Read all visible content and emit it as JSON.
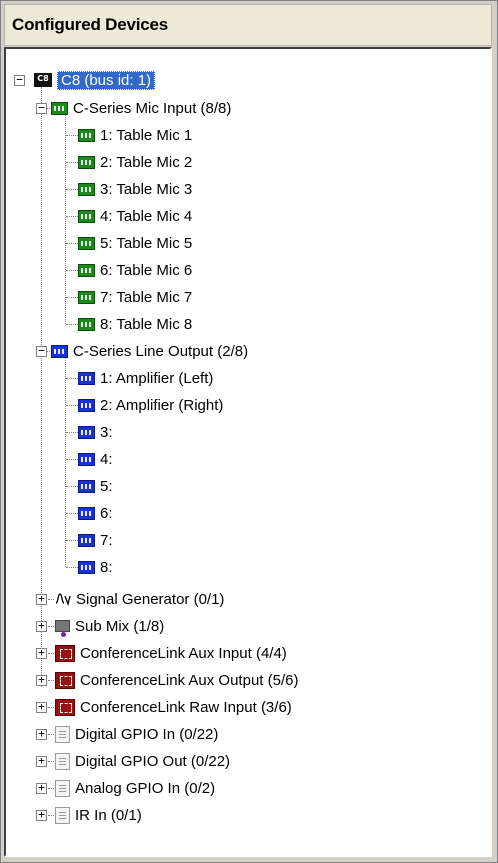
{
  "panel": {
    "title": "Configured Devices"
  },
  "device": {
    "icon_text": "C8",
    "label": "C8 (bus id: 1)"
  },
  "mic_group": {
    "label": "C-Series Mic Input (8/8)",
    "items": [
      "1: Table Mic 1",
      "2: Table Mic 2",
      "3: Table Mic 3",
      "4: Table Mic 4",
      "5: Table Mic 5",
      "6: Table Mic 6",
      "7: Table Mic 7",
      "8: Table Mic 8"
    ]
  },
  "line_group": {
    "label": "C-Series Line Output (2/8)",
    "items": [
      "1: Amplifier (Left)",
      "2: Amplifier (Right)",
      "3:",
      "4:",
      "5:",
      "6:",
      "7:",
      "8:"
    ]
  },
  "other_groups": [
    {
      "label": "Signal Generator (0/1)",
      "icon": "signal-generator-icon"
    },
    {
      "label": "Sub Mix (1/8)",
      "icon": "sub-mix-icon"
    },
    {
      "label": "ConferenceLink Aux Input (4/4)",
      "icon": "conferencelink-icon"
    },
    {
      "label": "ConferenceLink Aux Output (5/6)",
      "icon": "conferencelink-icon"
    },
    {
      "label": "ConferenceLink Raw Input (3/6)",
      "icon": "conferencelink-icon"
    },
    {
      "label": "Digital GPIO In (0/22)",
      "icon": "gpio-icon"
    },
    {
      "label": "Digital GPIO Out (0/22)",
      "icon": "gpio-icon"
    },
    {
      "label": "Analog GPIO In (0/2)",
      "icon": "gpio-icon"
    },
    {
      "label": "IR In (0/1)",
      "icon": "gpio-icon"
    }
  ],
  "glyphs": {
    "collapse": "−",
    "expand": "+"
  },
  "colors": {
    "selection": "#3169c6",
    "mic_icon": "#1b8a1b",
    "line_icon": "#1733d6",
    "conferencelink_icon": "#9a1010"
  }
}
